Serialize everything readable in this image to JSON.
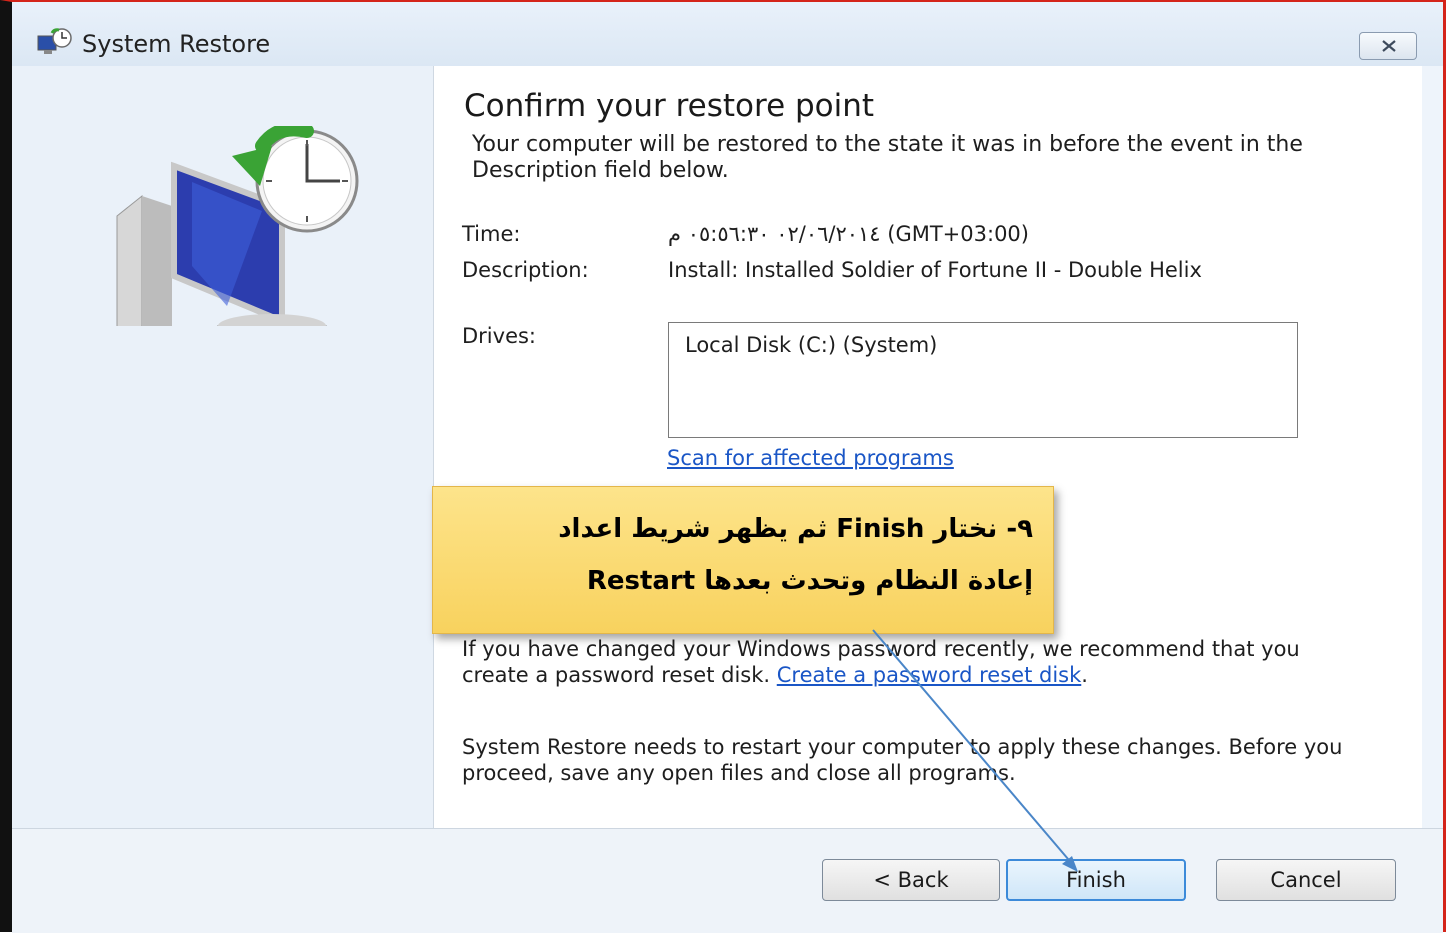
{
  "window": {
    "title": "System Restore",
    "app_icon": "system-restore-icon",
    "close_icon": "close-icon"
  },
  "main": {
    "heading": "Confirm your restore point",
    "intro": "Your computer will be restored to the state it was in before the event in the Description field below.",
    "time_label": "Time:",
    "time_value": "٠٢/٠٦/٢٠١٤ ٠٥:٥٦:٣٠ م (GMT+03:00)",
    "description_label": "Description:",
    "description_value": "Install: Installed Soldier of Fortune II - Double Helix",
    "drives_label": "Drives:",
    "drives": [
      "Local Disk (C:) (System)"
    ],
    "scan_link": "Scan for affected programs",
    "password_text": "If you have changed your Windows password recently, we recommend that you create a password reset disk.",
    "password_link": "Create a password reset disk",
    "restart_text": "System Restore needs to restart your computer to apply these changes. Before you proceed, save any open files and close all programs."
  },
  "buttons": {
    "back": "< Back",
    "finish": "Finish",
    "cancel": "Cancel"
  },
  "annotation": {
    "text": "٩- نختار Finish ثم يظهر شريط اعداد\nإعادة النظام وتحدث بعدها Restart",
    "background": "#f9d96c",
    "arrow_color": "#4a86c8"
  }
}
